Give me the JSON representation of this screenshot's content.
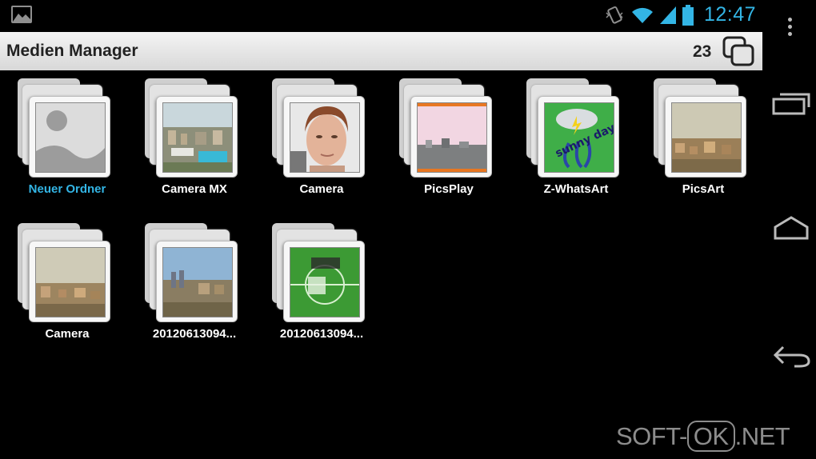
{
  "status_bar": {
    "time": "12:47",
    "accent_color": "#33b5e5",
    "icons": [
      "gallery-notification-icon",
      "vibrate-icon",
      "wifi-icon",
      "signal-icon",
      "battery-icon"
    ]
  },
  "action_bar": {
    "title": "Medien Manager",
    "count": "23",
    "windows_icon": "windows-icon"
  },
  "folders": [
    {
      "label": "Neuer Ordner",
      "active": true,
      "thumb": "placeholder"
    },
    {
      "label": "Camera MX",
      "active": false,
      "thumb": "city-pool"
    },
    {
      "label": "Camera",
      "active": false,
      "thumb": "face"
    },
    {
      "label": "PicsPlay",
      "active": false,
      "thumb": "city-pink"
    },
    {
      "label": "Z-WhatsArt",
      "active": false,
      "thumb": "sunny-day"
    },
    {
      "label": "PicsArt",
      "active": false,
      "thumb": "city-warm"
    },
    {
      "label": "Camera",
      "active": false,
      "thumb": "city-warm"
    },
    {
      "label": "20120613094...",
      "active": false,
      "thumb": "city-blue"
    },
    {
      "label": "20120613094...",
      "active": false,
      "thumb": "euro-grass"
    }
  ],
  "sunny_day_text": "sunny day",
  "nav_bar": {
    "icons": [
      "overflow-menu-icon",
      "recent-apps-icon",
      "home-icon",
      "back-icon"
    ]
  },
  "watermark": {
    "left": "SOFT-",
    "mid": "OK",
    "right": ".NET"
  }
}
